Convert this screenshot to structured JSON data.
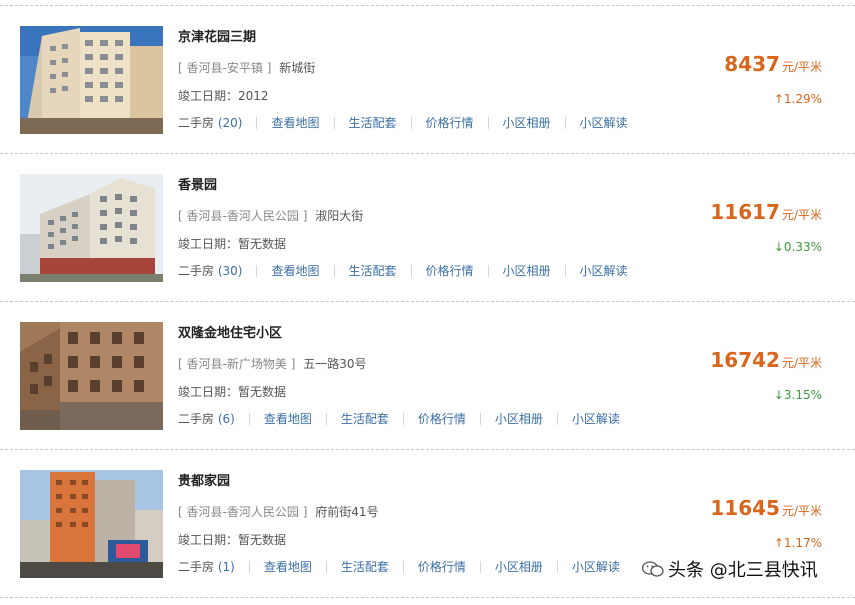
{
  "listings": [
    {
      "name": "京津花园三期",
      "bracket_open": "[",
      "region": "香河县-安平镇",
      "bracket_close": "]",
      "street": "新城街",
      "built": "竣工日期：2012",
      "used_label": "二手房",
      "used_count": "(20)",
      "links": [
        "查看地图",
        "生活配套",
        "价格行情",
        "小区相册",
        "小区解读"
      ],
      "price": "8437",
      "unit": "元/平米",
      "change": "↑1.29%",
      "trend": "up",
      "photo": "building-photo"
    },
    {
      "name": "香景园",
      "bracket_open": "[",
      "region": "香河县-香河人民公园",
      "bracket_close": "]",
      "street": "淑阳大街",
      "built": "竣工日期：暂无数据",
      "used_label": "二手房",
      "used_count": "(30)",
      "links": [
        "查看地图",
        "生活配套",
        "价格行情",
        "小区相册",
        "小区解读"
      ],
      "price": "11617",
      "unit": "元/平米",
      "change": "↓0.33%",
      "trend": "down",
      "photo": "building-photo"
    },
    {
      "name": "双隆金地住宅小区",
      "bracket_open": "[",
      "region": "香河县-新广场物美",
      "bracket_close": "]",
      "street": "五一路30号",
      "built": "竣工日期：暂无数据",
      "used_label": "二手房",
      "used_count": "(6)",
      "links": [
        "查看地图",
        "生活配套",
        "价格行情",
        "小区相册",
        "小区解读"
      ],
      "price": "16742",
      "unit": "元/平米",
      "change": "↓3.15%",
      "trend": "down",
      "photo": "building-photo"
    },
    {
      "name": "贵都家园",
      "bracket_open": "[",
      "region": "香河县-香河人民公园",
      "bracket_close": "]",
      "street": "府前街41号",
      "built": "竣工日期：暂无数据",
      "used_label": "二手房",
      "used_count": "(1)",
      "links": [
        "查看地图",
        "生活配套",
        "价格行情",
        "小区相册",
        "小区解读"
      ],
      "price": "11645",
      "unit": "元/平米",
      "change": "↑1.17%",
      "trend": "up",
      "photo": "building-photo"
    }
  ],
  "watermark": "头条 @北三县快讯",
  "colors": {
    "price": "#d8661c",
    "link": "#3b6fa5",
    "up": "#d8661c",
    "down": "#3e9a3e",
    "separator": "#c8c8c8"
  }
}
